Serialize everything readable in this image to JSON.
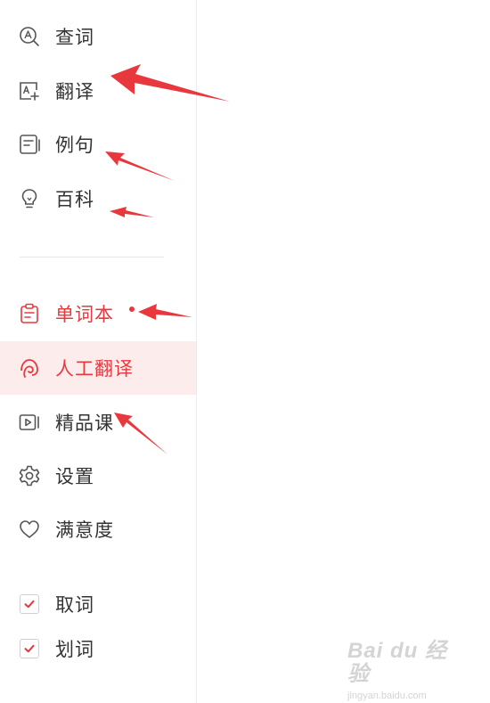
{
  "sidebar": {
    "items": [
      {
        "label": "查词",
        "icon": "search-a-icon"
      },
      {
        "label": "翻译",
        "icon": "translate-icon"
      },
      {
        "label": "例句",
        "icon": "document-icon"
      },
      {
        "label": "百科",
        "icon": "lightbulb-icon"
      },
      {
        "label": "单词本",
        "icon": "clipboard-icon"
      },
      {
        "label": "人工翻译",
        "icon": "headset-icon"
      },
      {
        "label": "精品课",
        "icon": "video-course-icon"
      },
      {
        "label": "设置",
        "icon": "gear-icon"
      },
      {
        "label": "满意度",
        "icon": "heart-icon"
      }
    ],
    "checks": [
      {
        "label": "取词",
        "checked": true
      },
      {
        "label": "划词",
        "checked": true
      }
    ]
  },
  "watermark": {
    "brand": "Bai du 经验",
    "url": "jingyan.baidu.com"
  },
  "colors": {
    "accent": "#e8383d",
    "active_bg": "#fdecec",
    "text": "#333333",
    "icon": "#555555",
    "annotation_arrow": "#e8383d"
  }
}
